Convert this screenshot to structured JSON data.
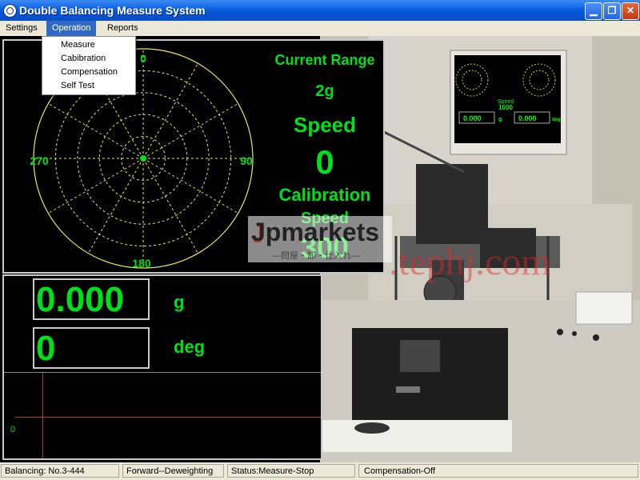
{
  "window": {
    "title": "Double Balancing Measure System"
  },
  "menu": {
    "items": [
      "Settings",
      "Operation",
      "Reports"
    ],
    "dropdown": [
      "Measure",
      "Cabibration",
      "Compensation",
      "Self Test"
    ]
  },
  "polar": {
    "labels": {
      "top": "0",
      "right": "90",
      "bottom": "180",
      "left": "270"
    }
  },
  "info": {
    "current_range_label": "Current Range",
    "current_range_value": "2g",
    "speed_label": "Speed",
    "speed_value": "0",
    "calibration_label": "Calibration",
    "calibration_speed_label": "Speed",
    "calibration_speed_value": "300"
  },
  "readout": {
    "amplitude": "0.000",
    "amplitude_unit": "g",
    "angle": "0",
    "angle_unit": "deg",
    "trace_zero": "0"
  },
  "watermark": {
    "brand": "Jpmarkets",
    "tagline": "—問屋・卸・仕入れ—",
    "url": ".tephj.com"
  },
  "monitor": {
    "speed_label": "Speed",
    "speed_value": "1000",
    "value_left": "0.000",
    "value_right": "0.000",
    "unit_g": "g",
    "unit_deg": "deg"
  },
  "status": {
    "balancing": "Balancing:  No.3-444",
    "mode": "Forward--Deweighting",
    "state": "Status:Measure-Stop",
    "compensation": "Compensation-Off"
  },
  "colors": {
    "accent_green": "#00e01a",
    "titlebar_blue": "#0a5fe0",
    "menu_highlight": "#316ac5"
  }
}
